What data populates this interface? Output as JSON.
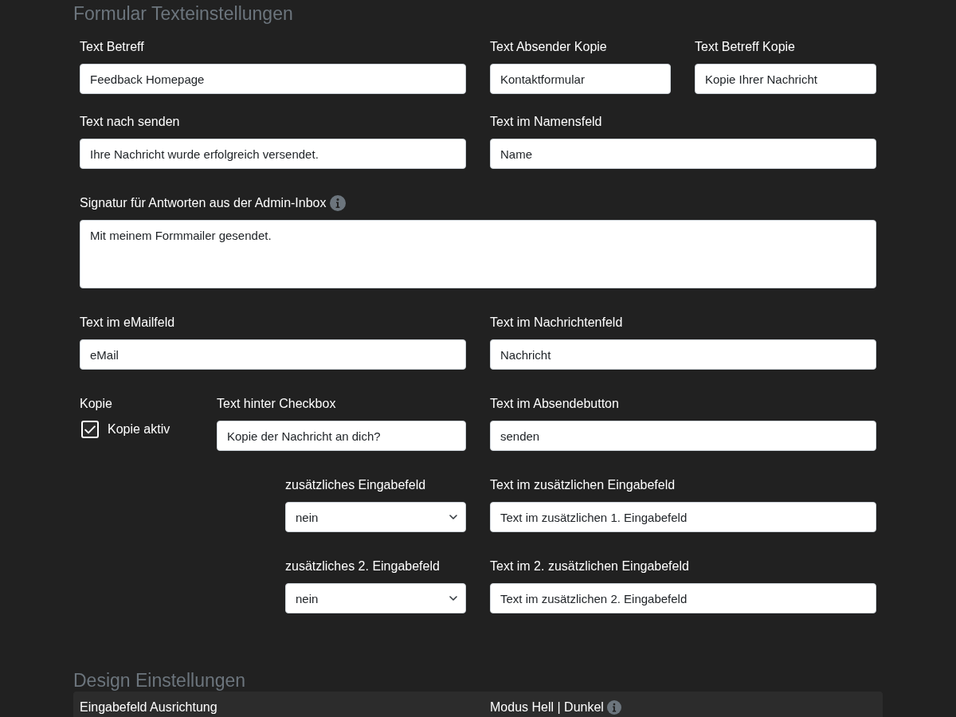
{
  "text_settings": {
    "title": "Formular Texteinstellungen",
    "rows": [
      {
        "fields": [
          {
            "kind": "input",
            "label": "Text Betreff",
            "value": "Feedback Homepage"
          },
          {
            "kind": "input",
            "label": "Text Absender Kopie",
            "value": "Kontaktformular"
          },
          {
            "kind": "input",
            "label": "Text Betreff Kopie",
            "value": "Kopie Ihrer Nachricht"
          }
        ]
      },
      {
        "fields": [
          {
            "kind": "input",
            "label": "Text nach senden",
            "value": "Ihre Nachricht wurde erfolgreich versendet."
          },
          {
            "kind": "input",
            "label": "Text im Namensfeld",
            "value": "Name"
          }
        ]
      },
      {
        "fields": [
          {
            "kind": "textarea",
            "label": "Signatur für Antworten aus der Admin-Inbox",
            "info_icon": true,
            "value": "Mit meinem Formmailer gesendet."
          }
        ]
      },
      {
        "fields": [
          {
            "kind": "input",
            "label": "Text im eMailfeld",
            "value": "eMail"
          },
          {
            "kind": "input",
            "label": "Text im Nachrichtenfeld",
            "value": "Nachricht"
          }
        ]
      },
      {
        "fields": [
          {
            "kind": "checkbox",
            "label": "Kopie",
            "option": "Kopie aktiv",
            "checked": true
          },
          {
            "kind": "input",
            "label": "Text hinter Checkbox",
            "value": "Kopie der Nachricht an dich?"
          },
          {
            "kind": "input",
            "label": "Text im Absendebutton",
            "value": "senden"
          }
        ]
      },
      {
        "fields": [
          {
            "kind": "select",
            "label": "zusätzliches Eingabefeld",
            "value": "nein"
          },
          {
            "kind": "input",
            "label": "Text im zusätzlichen Eingabefeld",
            "value": "Text im zusätzlichen 1. Eingabefeld"
          }
        ]
      },
      {
        "fields": [
          {
            "kind": "select",
            "label": "zusätzliches 2. Eingabefeld",
            "value": "nein"
          },
          {
            "kind": "input",
            "label": "Text im 2. zusätzlichen Eingabefeld",
            "value": "Text im zusätzlichen 2. Eingabefeld"
          }
        ]
      }
    ]
  },
  "design_settings": {
    "title": "Design Einstellungen",
    "rows": [
      {
        "fields": [
          {
            "label": "Eingabefeld Ausrichtung"
          },
          {
            "label": "Modus Hell | Dunkel",
            "info_icon": true
          }
        ]
      }
    ]
  }
}
